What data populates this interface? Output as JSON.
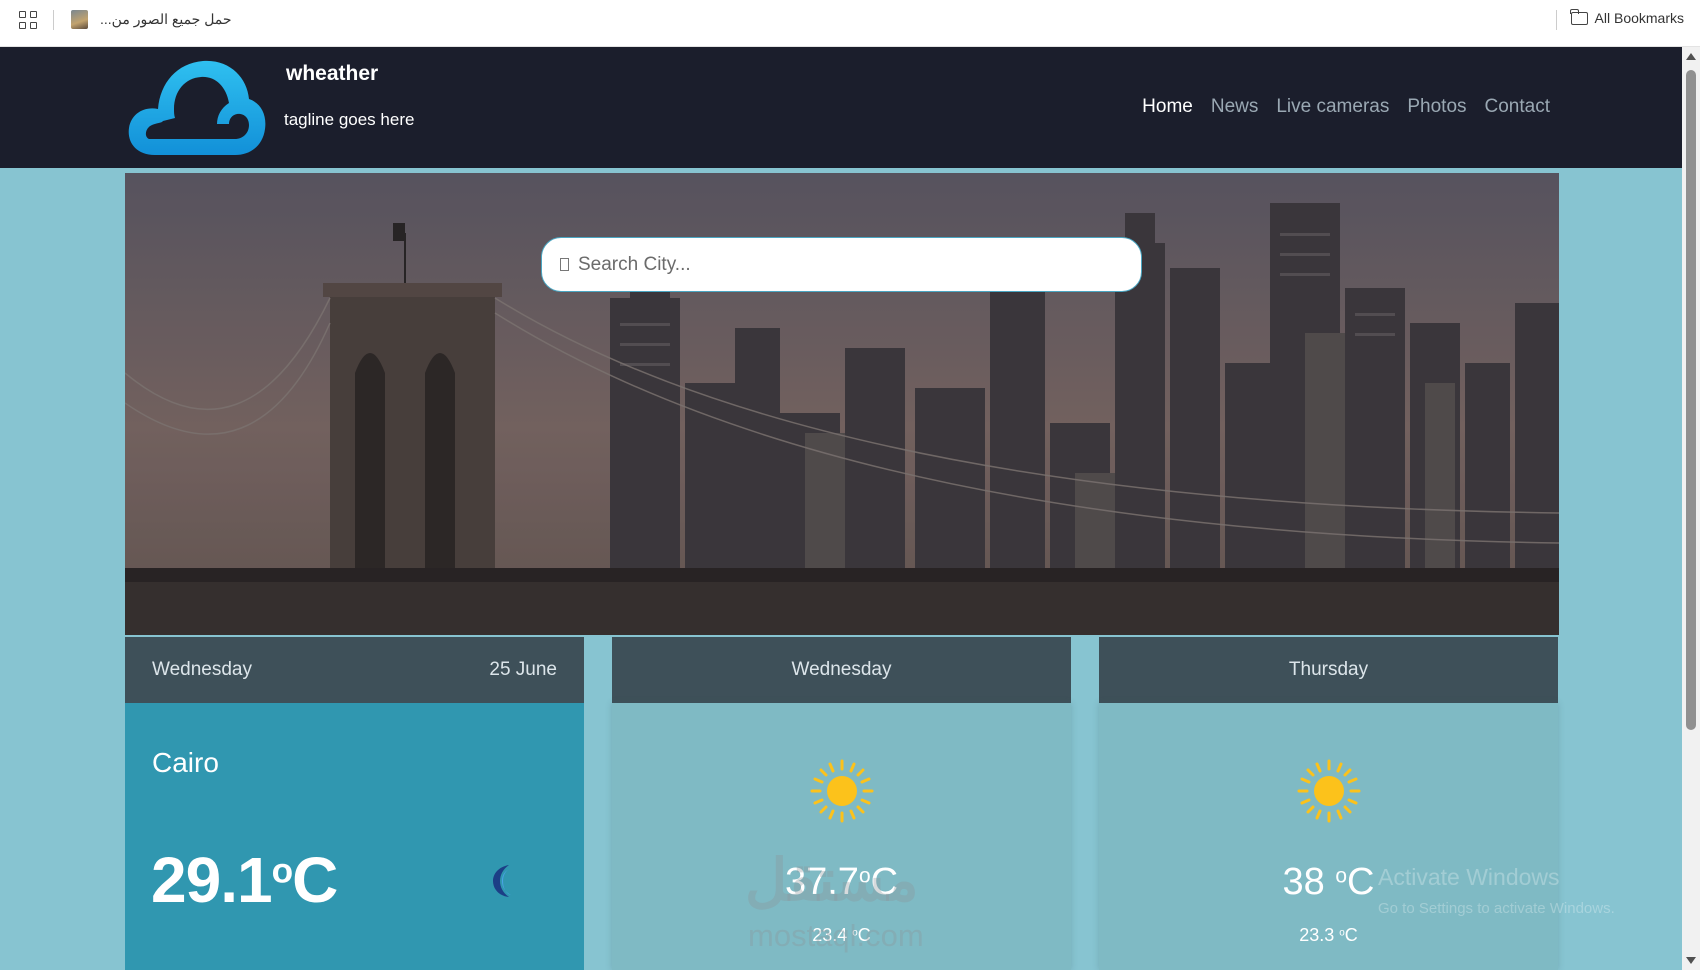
{
  "bookmarks_bar": {
    "bookmark_text": "حمل جميع الصور من...",
    "all_bookmarks": "All Bookmarks"
  },
  "header": {
    "site_title": "wheather",
    "tagline": "tagline goes here",
    "nav": [
      "Home",
      "News",
      "Live cameras",
      "Photos",
      "Contact"
    ],
    "active_nav": "Home"
  },
  "search": {
    "placeholder": "Search City..."
  },
  "today": {
    "day": "Wednesday",
    "date": "25 June",
    "city": "Cairo",
    "temp": "29.1",
    "unit_sup": "o",
    "unit": "C",
    "icon": "moon-icon"
  },
  "forecast": [
    {
      "day": "Wednesday",
      "max": "37.7",
      "max_unit": "C",
      "min": "23.4",
      "min_unit": "C",
      "icon": "sun-icon"
    },
    {
      "day": "Thursday",
      "max": "38",
      "max_unit": "C",
      "min": "23.3",
      "min_unit": "C",
      "icon": "sun-icon"
    }
  ],
  "watermarks": {
    "logo_text": "مستقل",
    "logo_url_text": "mostaql.com",
    "activation_title": "Activate Windows",
    "activation_sub": "Go to Settings to activate Windows."
  },
  "colors": {
    "page_bg": "#87c4d1",
    "header_bg": "#1b1e2c",
    "card_head_bg": "#3e5059",
    "today_body_bg": "#3097b0",
    "forecast_body_bg": "#7fbac4",
    "sun": "#fcc21b"
  }
}
